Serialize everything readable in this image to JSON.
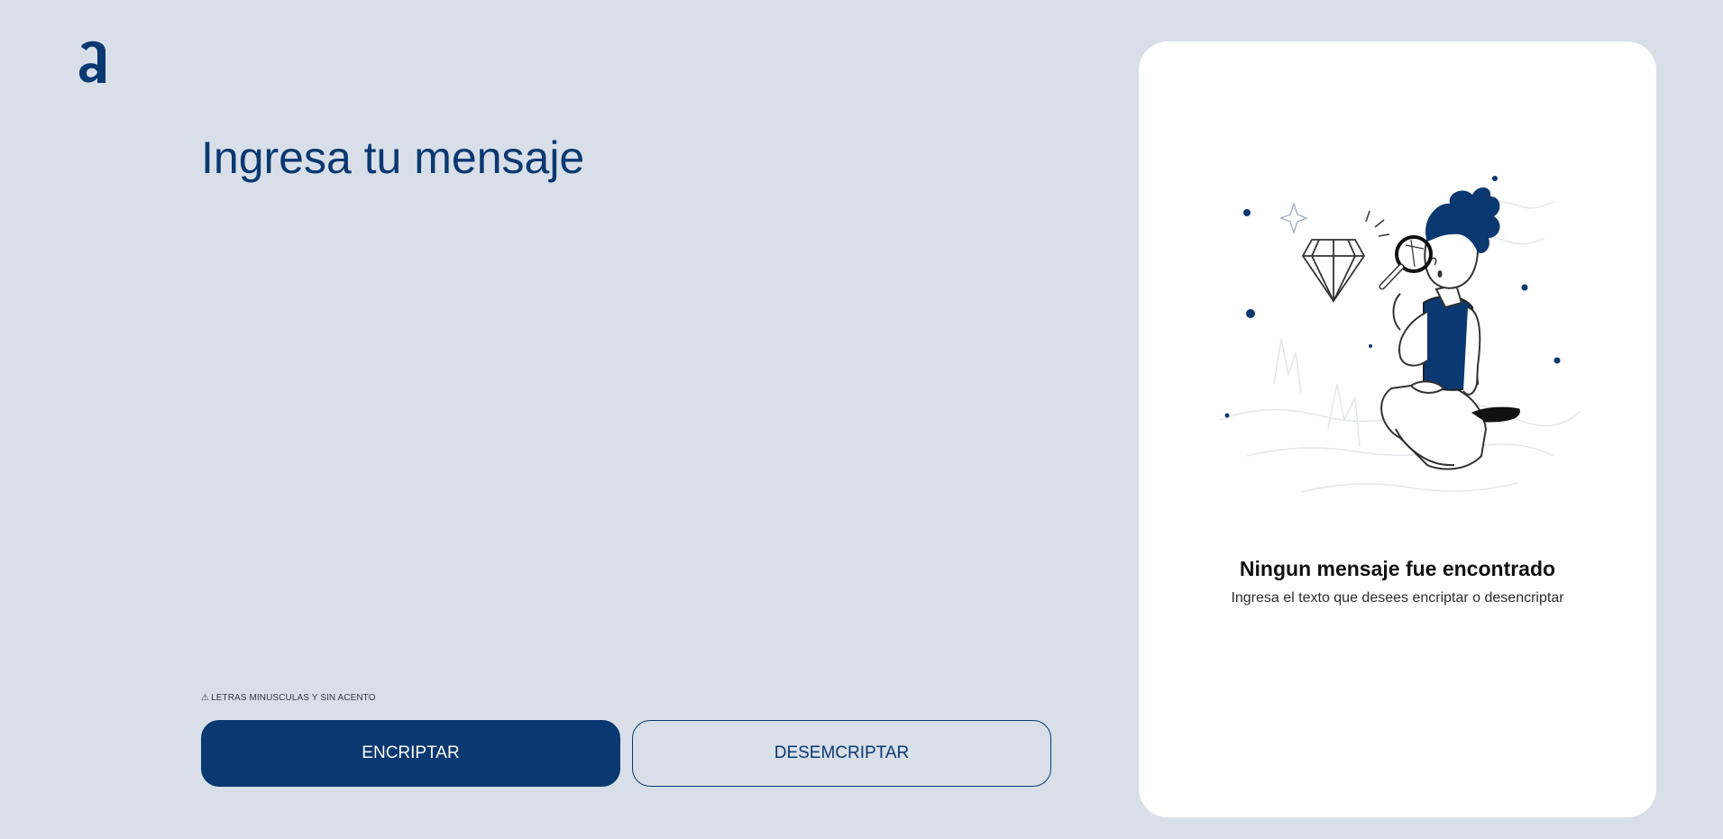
{
  "logo": {
    "name": "a-logo-icon",
    "color": "#0a3871"
  },
  "main": {
    "input_placeholder": "Ingresa tu mensaje",
    "input_value": "",
    "hint_icon": "⚠",
    "hint_text": "LETRAS MINUSCULAS Y SIN ACENTO",
    "encrypt_label": "ENCRIPTAR",
    "decrypt_label": "DESEMCRIPTAR"
  },
  "result": {
    "title": "Ningun mensaje fue encontrado",
    "subtitle": "Ingresa el texto que desees encriptar o desencriptar",
    "illustration_icon": "person-magnifying-glass-diamond-illustration"
  },
  "colors": {
    "background": "#d8dfe9",
    "accent": "#0a3871",
    "card": "#ffffff"
  }
}
